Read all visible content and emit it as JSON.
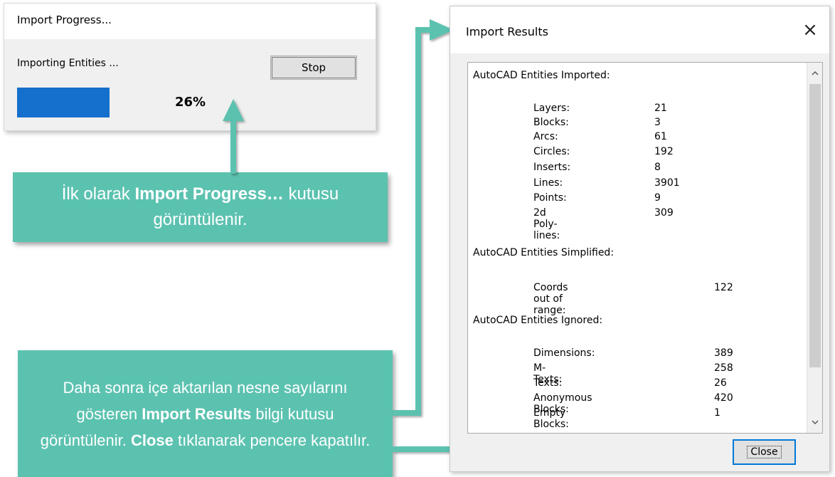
{
  "progress_dialog": {
    "title": "Import Progress...",
    "status": "Importing Entities ...",
    "stop_label": "Stop",
    "progress_fraction": 0.26,
    "progress_text": "26%",
    "bar_color": "#1470cc"
  },
  "results_dialog": {
    "title": "Import Results",
    "close_x_glyph": "×",
    "close_label": "Close",
    "sections": [
      {
        "header": "AutoCAD Entities Imported:",
        "rows": [
          {
            "label": "Layers:",
            "value": "21"
          },
          {
            "label": "Blocks:",
            "value": "3"
          },
          {
            "label": "Arcs:",
            "value": "61"
          },
          {
            "label": "Circles:",
            "value": "192"
          },
          {
            "label": "Inserts:",
            "value": "8"
          },
          {
            "label": "Lines:",
            "value": "3901"
          },
          {
            "label": "Points:",
            "value": "9"
          },
          {
            "label": "2d Poly-lines:",
            "value": "309"
          }
        ]
      },
      {
        "header": "AutoCAD Entities Simplified:",
        "rows": [
          {
            "label": "Coords out of range:",
            "value": "122"
          }
        ]
      },
      {
        "header": "AutoCAD Entities Ignored:",
        "rows": [
          {
            "label": "Dimensions:",
            "value": "389"
          },
          {
            "label": "M-Texts:",
            "value": "258"
          },
          {
            "label": "Texts:",
            "value": "26"
          },
          {
            "label": "Anonymous Blocks:",
            "value": "420"
          },
          {
            "label": "Empty Blocks:",
            "value": "1"
          }
        ]
      }
    ]
  },
  "callouts": {
    "first": {
      "text_1": "İlk olarak ",
      "bold_1": "Import Progress…",
      "text_2": " kutusu görüntülenir."
    },
    "second": {
      "text_1": "Daha sonra içe aktarılan nesne sayılarını gösteren ",
      "bold_1": "Import Results",
      "text_2": " bilgi kutusu görüntülenir. ",
      "bold_2": "Close",
      "text_3": " tıklanarak pencere kapatılır."
    }
  },
  "colors": {
    "callout": "#5cc2b0",
    "accent_blue": "#0078d7"
  }
}
